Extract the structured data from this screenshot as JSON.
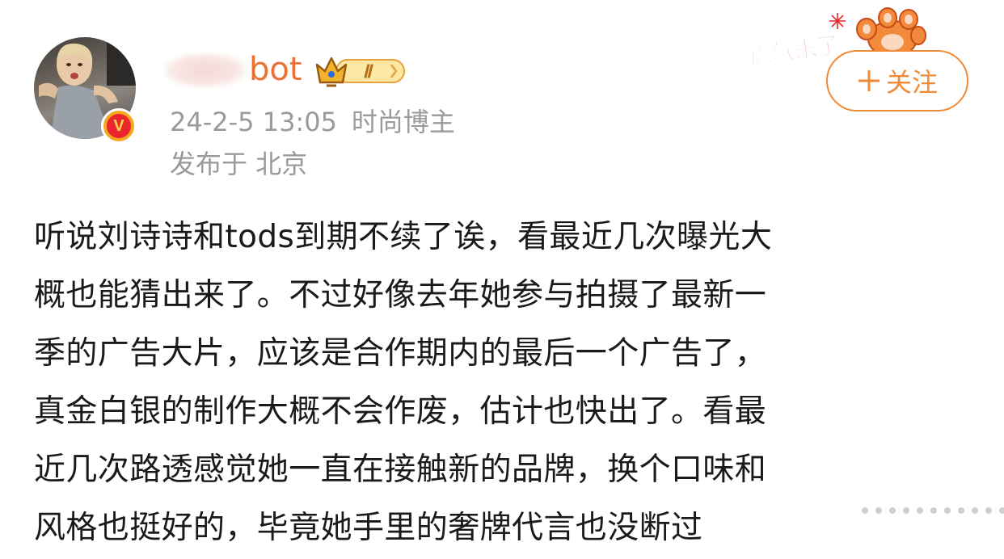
{
  "post": {
    "author_name": "bot",
    "author_level": "Ⅱ",
    "verified_mark": "V",
    "timestamp": "24-2-5 13:05",
    "author_tag": "时尚博主",
    "location": "发布于 北京",
    "follow_label": "关注",
    "follow_icon": "plus-icon",
    "sticker_text": "虎气来了",
    "body_lines": [
      "听说刘诗诗和tods到期不续了诶，看最近几次曝光大",
      "概也能猜出来了。不过好像去年她参与拍摄了最新一",
      "季的广告大片，应该是合作期内的最后一个广告了，",
      "真金白银的制作大概不会作废，估计也快出了。看最",
      "近几次路透感觉她一直在接触新的品牌，换个口味和",
      "风格也挺好的，毕竟她手里的奢牌代言也没断过"
    ]
  },
  "colors": {
    "name": "#eb7233",
    "follow": "#f08a36",
    "meta": "#9a9a9a",
    "text": "#1a1a1a"
  }
}
